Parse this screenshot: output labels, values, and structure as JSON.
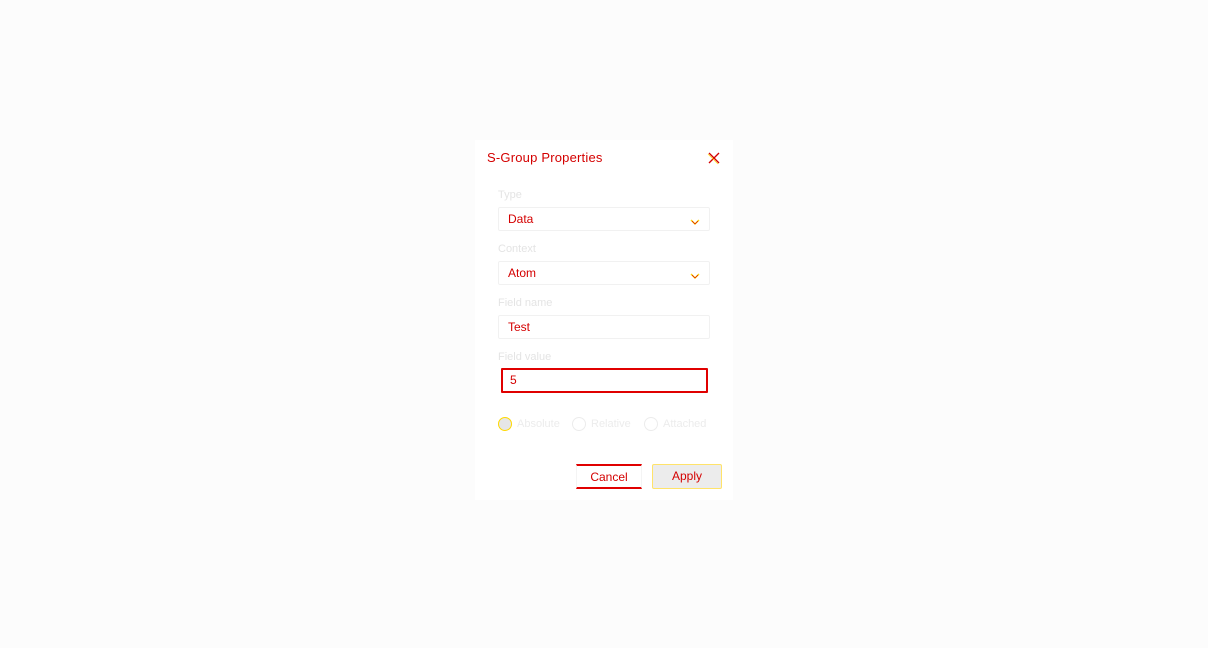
{
  "dialog": {
    "title": "S-Group Properties",
    "close_icon": "close-icon"
  },
  "form": {
    "type": {
      "label": "Type",
      "value": "Data"
    },
    "context": {
      "label": "Context",
      "value": "Atom"
    },
    "field_name": {
      "label": "Field name",
      "value": "Test"
    },
    "field_value": {
      "label": "Field value",
      "value": "5"
    }
  },
  "position": {
    "options": [
      "Absolute",
      "Relative",
      "Attached"
    ],
    "selected": "Absolute"
  },
  "buttons": {
    "cancel_label": "Cancel",
    "apply_label": "Apply"
  },
  "colors": {
    "accent": "#d40000",
    "focus_border": "#e00000",
    "highlight": "#ffd800"
  }
}
